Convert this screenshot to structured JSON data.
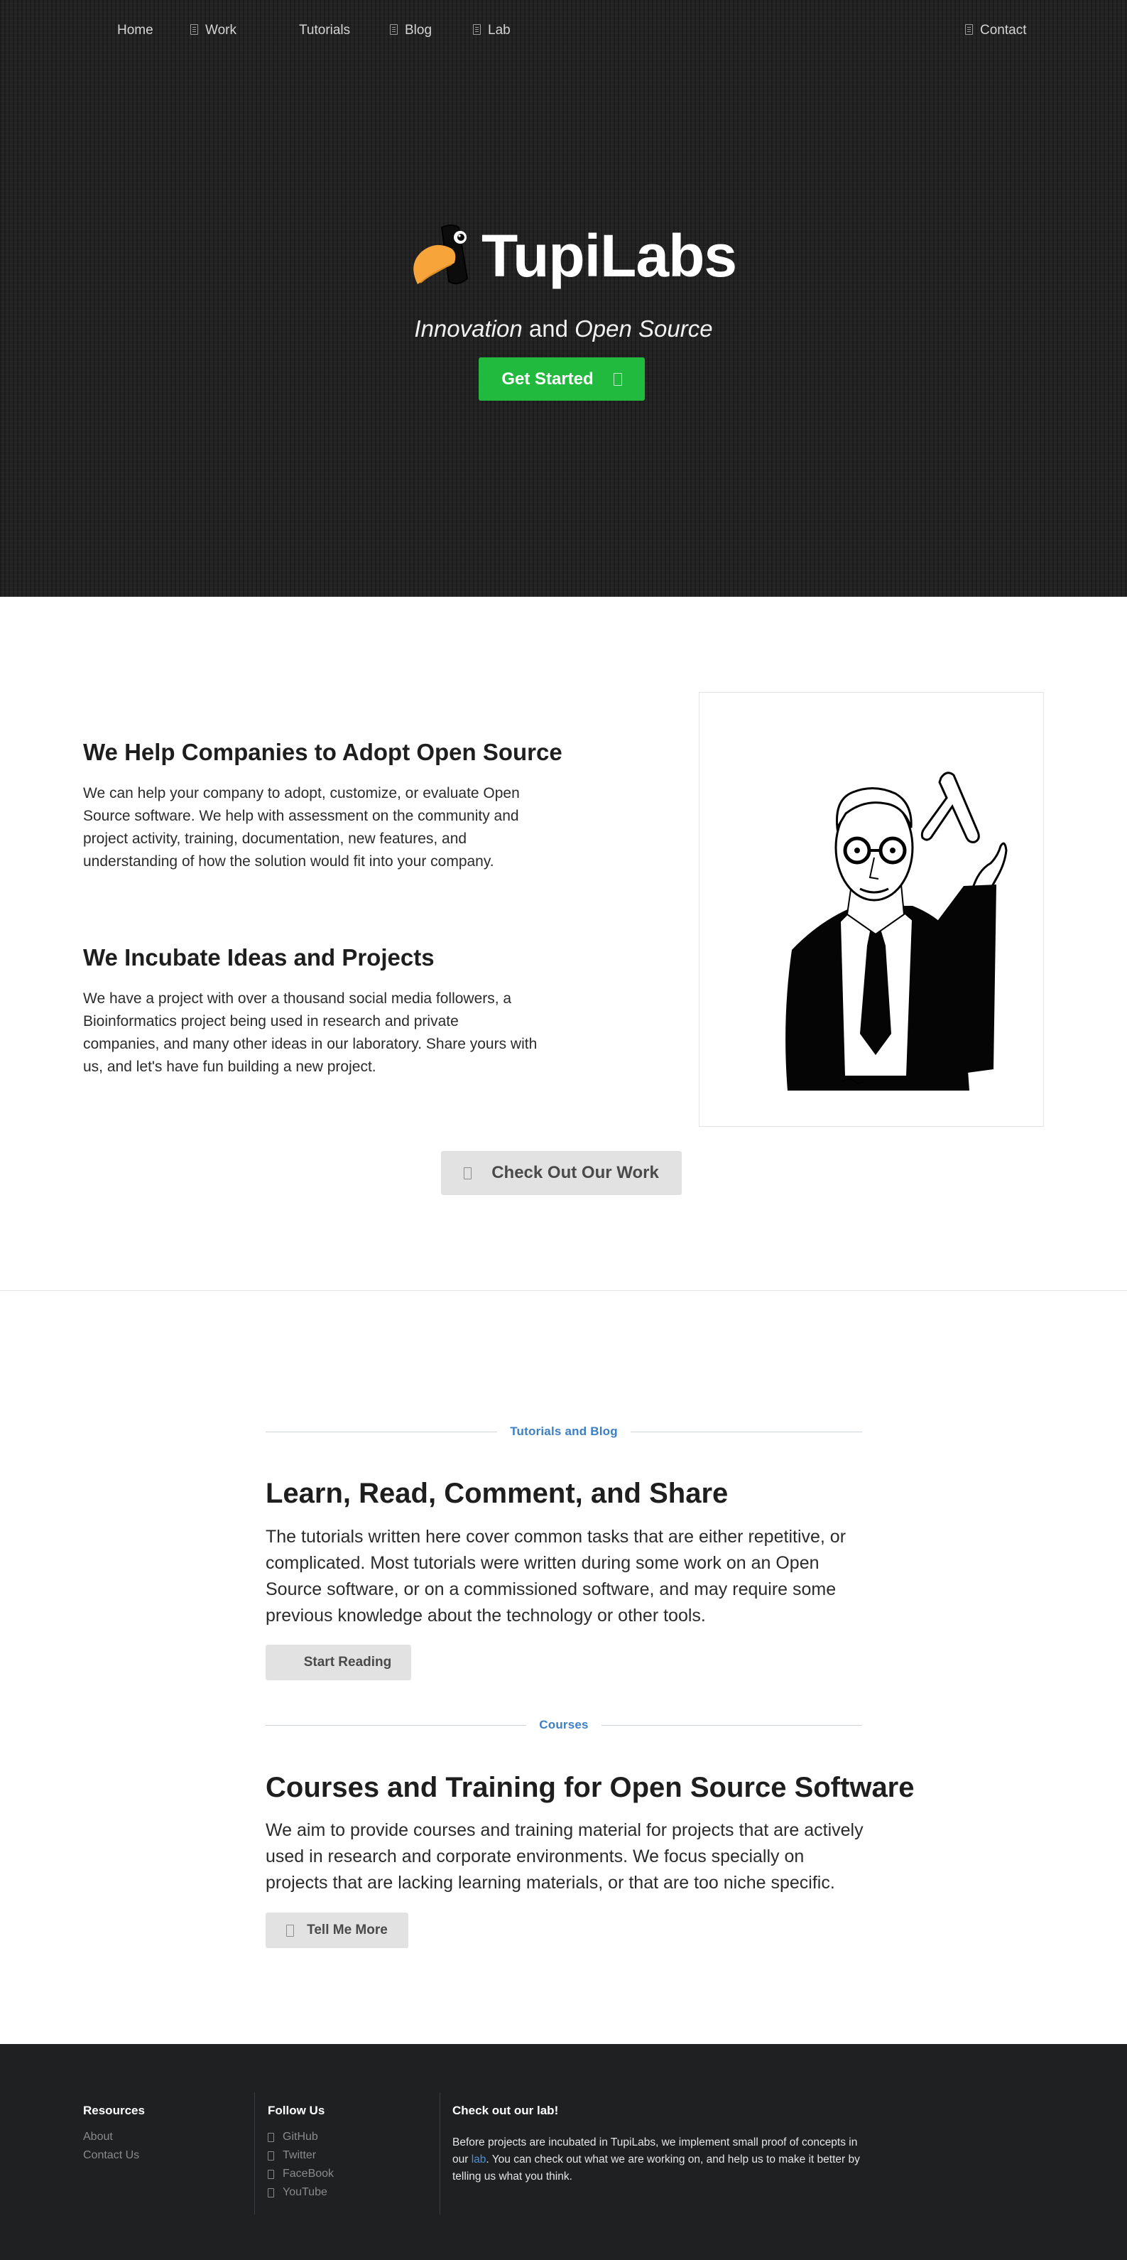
{
  "nav": {
    "home": "Home",
    "work": "Work",
    "tutorials": "Tutorials",
    "blog": "Blog",
    "lab": "Lab",
    "contact": "Contact"
  },
  "hero": {
    "logo_text": "TupiLabs",
    "tagline_em1": "Innovation",
    "tagline_mid": " and ",
    "tagline_em2": "Open Source",
    "cta_label": "Get Started"
  },
  "services": {
    "adopt_title": "We Help Companies to Adopt Open Source",
    "adopt_text": "We can help your company to adopt, customize, or evaluate Open Source software. We help with assessment on the community and project activity, training, documentation, new features, and understanding of how the solution would fit into your company.",
    "incubate_title": "We Incubate Ideas and Projects",
    "incubate_text": "We have a project with over a thousand social media followers, a Bioinformatics project being used in research and private companies, and many other ideas in our laboratory. Share yours with us, and let's have fun building a new project.",
    "work_button": "Check Out Our Work"
  },
  "blog": {
    "label": "Tutorials and Blog",
    "title": "Learn, Read, Comment, and Share",
    "text": "The tutorials written here cover common tasks that are either repetitive, or complicated. Most tutorials were written during some work on an Open Source software, or on a commissioned software, and may require some previous knowledge about the technology or other tools.",
    "button": "Start Reading"
  },
  "courses": {
    "label": "Courses",
    "title": "Courses and Training for Open Source Software",
    "text": "We aim to provide courses and training material for projects that are actively used in research and corporate environments. We focus specially on projects that are lacking learning materials, or that are too niche specific.",
    "button": "Tell Me More"
  },
  "footer": {
    "resources_head": "Resources",
    "resources": [
      "About",
      "Contact Us"
    ],
    "follow_head": "Follow Us",
    "follow": [
      "GitHub",
      "Twitter",
      "FaceBook",
      "YouTube"
    ],
    "lab_head": "Check out our lab!",
    "lab_text_1": "Before projects are incubated in TupiLabs, we implement small proof of concepts in our ",
    "lab_link": "lab",
    "lab_text_2": ". You can check out what we are working on, and help us to make it better by telling us what you think."
  },
  "colors": {
    "hero_bg": "#232323",
    "cta_green": "#21b93e",
    "accent_blue": "#3d7fc2",
    "footer_bg": "#1f2022",
    "toucan_orange": "#f7a43a"
  }
}
